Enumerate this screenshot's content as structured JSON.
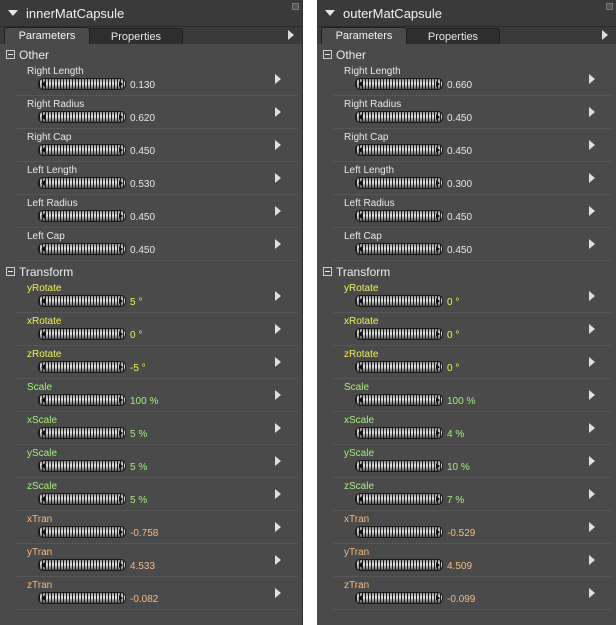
{
  "panels": [
    {
      "title": "innerMatCapsule",
      "tabs": [
        "Parameters",
        "Properties"
      ],
      "groups": [
        {
          "label": "Other",
          "rows": [
            {
              "label": "Right Length",
              "value": "0.130",
              "color": "#e8e8e8"
            },
            {
              "label": "Right Radius",
              "value": "0.620",
              "color": "#e8e8e8"
            },
            {
              "label": "Right Cap",
              "value": "0.450",
              "color": "#e8e8e8"
            },
            {
              "label": "Left Length",
              "value": "0.530",
              "color": "#e8e8e8"
            },
            {
              "label": "Left Radius",
              "value": "0.450",
              "color": "#e8e8e8"
            },
            {
              "label": "Left Cap",
              "value": "0.450",
              "color": "#e8e8e8"
            }
          ]
        },
        {
          "label": "Transform",
          "rows": [
            {
              "label": "yRotate",
              "value": "5 °",
              "color": "#f0f05a"
            },
            {
              "label": "xRotate",
              "value": "0 °",
              "color": "#f0f05a"
            },
            {
              "label": "zRotate",
              "value": "-5 °",
              "color": "#f0f05a"
            },
            {
              "label": "Scale",
              "value": "100 %",
              "color": "#a6ea80"
            },
            {
              "label": "xScale",
              "value": "5 %",
              "color": "#a6ea80"
            },
            {
              "label": "yScale",
              "value": "5 %",
              "color": "#a6ea80"
            },
            {
              "label": "zScale",
              "value": "5 %",
              "color": "#a6ea80"
            },
            {
              "label": "xTran",
              "value": "-0.758",
              "color": "#f5b880"
            },
            {
              "label": "yTran",
              "value": "4.533",
              "color": "#f5b880"
            },
            {
              "label": "zTran",
              "value": "-0.082",
              "color": "#f5b880"
            }
          ]
        }
      ]
    },
    {
      "title": "outerMatCapsule",
      "tabs": [
        "Parameters",
        "Properties"
      ],
      "groups": [
        {
          "label": "Other",
          "rows": [
            {
              "label": "Right Length",
              "value": "0.660",
              "color": "#e8e8e8"
            },
            {
              "label": "Right Radius",
              "value": "0.450",
              "color": "#e8e8e8"
            },
            {
              "label": "Right Cap",
              "value": "0.450",
              "color": "#e8e8e8"
            },
            {
              "label": "Left Length",
              "value": "0.300",
              "color": "#e8e8e8"
            },
            {
              "label": "Left Radius",
              "value": "0.450",
              "color": "#e8e8e8"
            },
            {
              "label": "Left Cap",
              "value": "0.450",
              "color": "#e8e8e8"
            }
          ]
        },
        {
          "label": "Transform",
          "rows": [
            {
              "label": "yRotate",
              "value": "0 °",
              "color": "#f0f05a"
            },
            {
              "label": "xRotate",
              "value": "0 °",
              "color": "#f0f05a"
            },
            {
              "label": "zRotate",
              "value": "0 °",
              "color": "#f0f05a"
            },
            {
              "label": "Scale",
              "value": "100 %",
              "color": "#a6ea80"
            },
            {
              "label": "xScale",
              "value": "4 %",
              "color": "#a6ea80"
            },
            {
              "label": "yScale",
              "value": "10 %",
              "color": "#a6ea80"
            },
            {
              "label": "zScale",
              "value": "7 %",
              "color": "#a6ea80"
            },
            {
              "label": "xTran",
              "value": "-0.529",
              "color": "#f5b880"
            },
            {
              "label": "yTran",
              "value": "4.509",
              "color": "#f5b880"
            },
            {
              "label": "zTran",
              "value": "-0.099",
              "color": "#f5b880"
            }
          ]
        }
      ]
    }
  ]
}
